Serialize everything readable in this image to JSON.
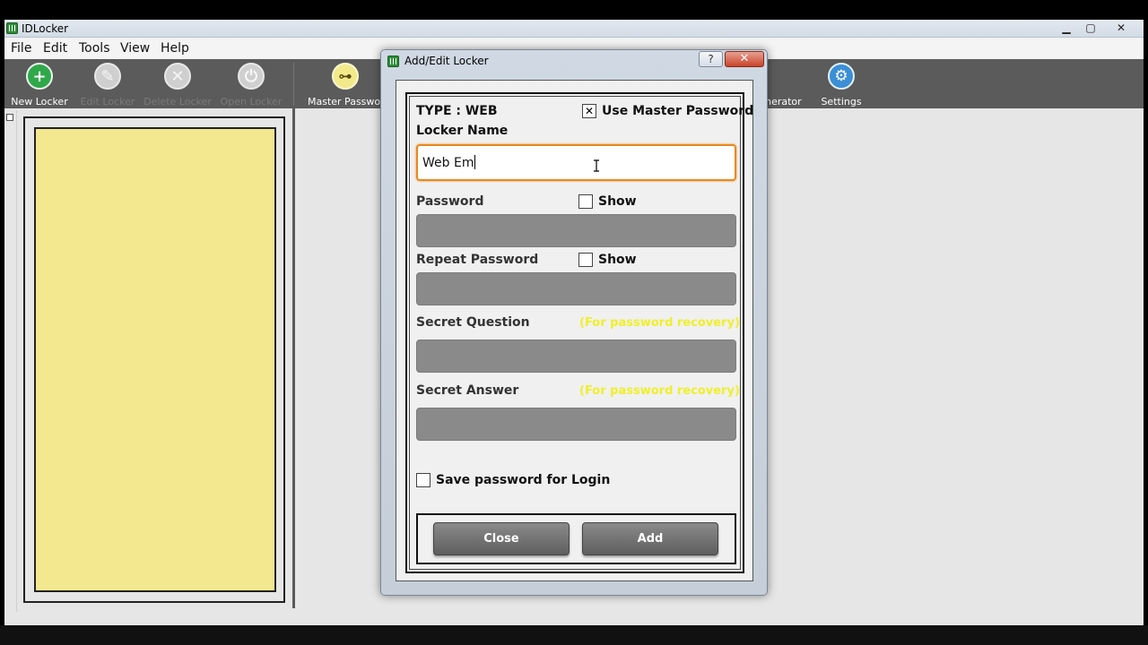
{
  "window": {
    "title": "IDLocker"
  },
  "menu": [
    "File",
    "Edit",
    "Tools",
    "View",
    "Help"
  ],
  "toolbar": {
    "new_locker": "New Locker",
    "edit_locker": "Edit Locker",
    "delete_locker": "Delete Locker",
    "open_locker": "Open Locker",
    "master_password": "Master Password",
    "generator": "enerator",
    "settings": "Settings"
  },
  "dialog": {
    "title": "Add/Edit Locker",
    "help_label": "?",
    "close_label": "✕",
    "type_label": "TYPE : WEB",
    "use_master_password": {
      "label": "Use Master Password",
      "checked": true,
      "mark": "✕"
    },
    "locker_name": {
      "label": "Locker Name",
      "value": "Web Em"
    },
    "password": {
      "label": "Password",
      "show_label": "Show"
    },
    "repeat_password": {
      "label": "Repeat Password",
      "show_label": "Show"
    },
    "secret_question": {
      "label": "Secret Question",
      "hint": "(For password recovery)"
    },
    "secret_answer": {
      "label": "Secret Answer",
      "hint": "(For password recovery)"
    },
    "save_password": {
      "label": "Save password for Login"
    },
    "buttons": {
      "close": "Close",
      "add": "Add"
    }
  },
  "colors": {
    "toolbar_bg": "#5b5b5b",
    "locker_list_bg": "#f3e78f",
    "focus_border": "#e8891d",
    "hint_text": "#f0ef2a",
    "field_bg": "#8a8a8a"
  }
}
